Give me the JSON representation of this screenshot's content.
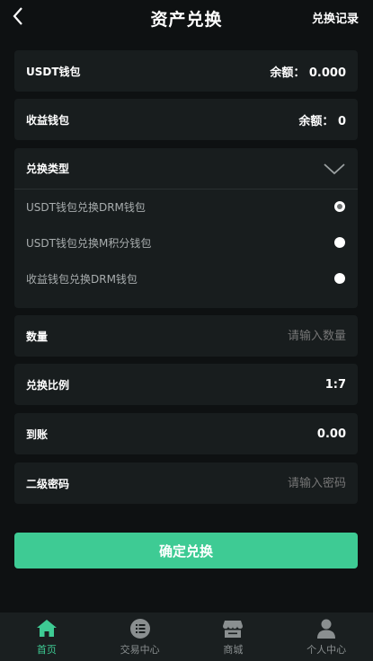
{
  "header": {
    "title": "资产兑换",
    "records_link": "兑换记录"
  },
  "wallets": {
    "usdt": {
      "label": "USDT钱包",
      "balance_label": "余额：",
      "balance": "0.000"
    },
    "income": {
      "label": "收益钱包",
      "balance_label": "余额：",
      "balance": "0"
    }
  },
  "exchange_type": {
    "label": "兑换类型",
    "options": [
      {
        "label": "USDT钱包兑换DRM钱包",
        "selected": true
      },
      {
        "label": "USDT钱包兑换M积分钱包",
        "selected": false
      },
      {
        "label": "收益钱包兑换DRM钱包",
        "selected": false
      }
    ]
  },
  "form": {
    "quantity": {
      "label": "数量",
      "placeholder": "请输入数量"
    },
    "ratio": {
      "label": "兑换比例",
      "value": "1:7"
    },
    "arrival": {
      "label": "到账",
      "value": "0.00"
    },
    "password": {
      "label": "二级密码",
      "placeholder": "请输入密码"
    }
  },
  "confirm_label": "确定兑换",
  "tabbar": [
    {
      "label": "首页",
      "icon": "home-icon",
      "active": true
    },
    {
      "label": "交易中心",
      "icon": "list-icon",
      "active": false
    },
    {
      "label": "商城",
      "icon": "shop-icon",
      "active": false
    },
    {
      "label": "个人中心",
      "icon": "user-icon",
      "active": false
    }
  ],
  "colors": {
    "accent": "#3ecb94",
    "background": "#0e1112",
    "card": "#181d1e"
  }
}
